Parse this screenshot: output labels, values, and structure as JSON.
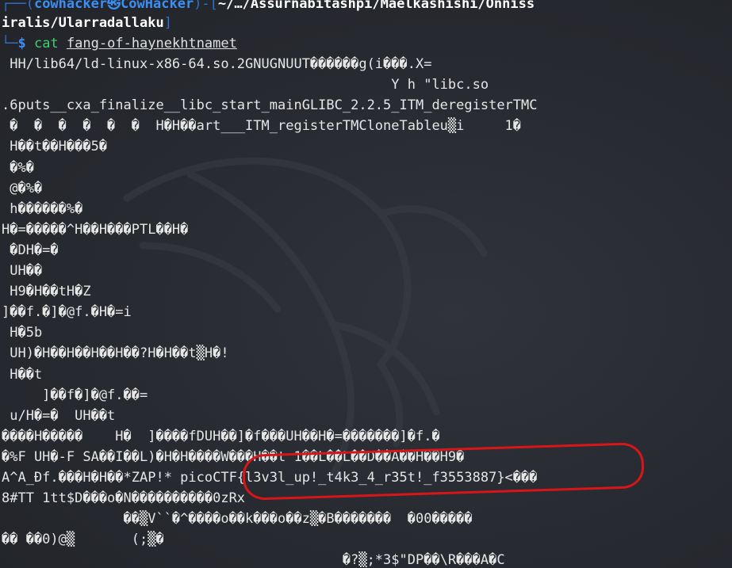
{
  "prompt": {
    "corner_top": "┌──(",
    "user_host": "cowhacker㉿CowHacker",
    "sep": ")-[",
    "path_part1": "~/…/Assurnabitashpi/Maelkashishi/Onniss",
    "path_part2": "iralis/Ularradallaku",
    "path_close": "]",
    "corner_bottom": "└─",
    "dollar": "$ ",
    "command": "cat",
    "argument": "fang-of-haynekhtnamet"
  },
  "output_lines": [
    " HH/lib64/ld-linux-x86-64.so.2GNUGNUUT������g(i���.X=",
    "                                                Y h \"libc.so",
    ".6puts__cxa_finalize__libc_start_mainGLIBC_2.2.5_ITM_deregisterTMC",
    " �  �  �  �  �  �  H�H��art___ITM_registerTMCloneTableu▒i     1�",
    " H��t��H���5�",
    " �%�",
    " @�%�",
    " h������%�",
    "H�=�����^H��H���PTL��H�",
    " �DH�=�",
    " UH��",
    " H9�H��tH�Z",
    "]��f.�]�@f.�H�=i",
    " H�5b",
    " UH)�H��H��H��H��?H�H��t▒H�!",
    " H��t",
    "     ]��f�]�@f.��=",
    " u/H�=�  UH��t",
    "����H�����    H�  ]����fDUH��]�f���UH��H�=�������]�f.�",
    "�%F UH�-F SA��I��L)�H�H����W���H��t 1��L��L��D��A��H��H9�",
    "A^A_Ðf.���H�H��*ZAP!* picoCTF{l3v3l_up!_t4k3_4_r35t!_f3553887}<���",
    "8#TT 1tt$D���o�N����������0zRx",
    "               ��▒V``�^����o��k���o��z▒�B�������  �00�����",
    "�� ��0)@▒       (;▒�",
    "                                          �?▒;*3$\"DP��\\R���A�C"
  ],
  "flag_text": "picoCTF{l3v3l_up!_t4k3_4_r35t!_f3553887}",
  "colors": {
    "background": "#26282e",
    "prompt_blue": "#3b8ff2",
    "command_green": "#3fd06a",
    "annotation_red": "#d8161a"
  },
  "icons": {
    "background_logo": "kali-dragon-icon"
  }
}
